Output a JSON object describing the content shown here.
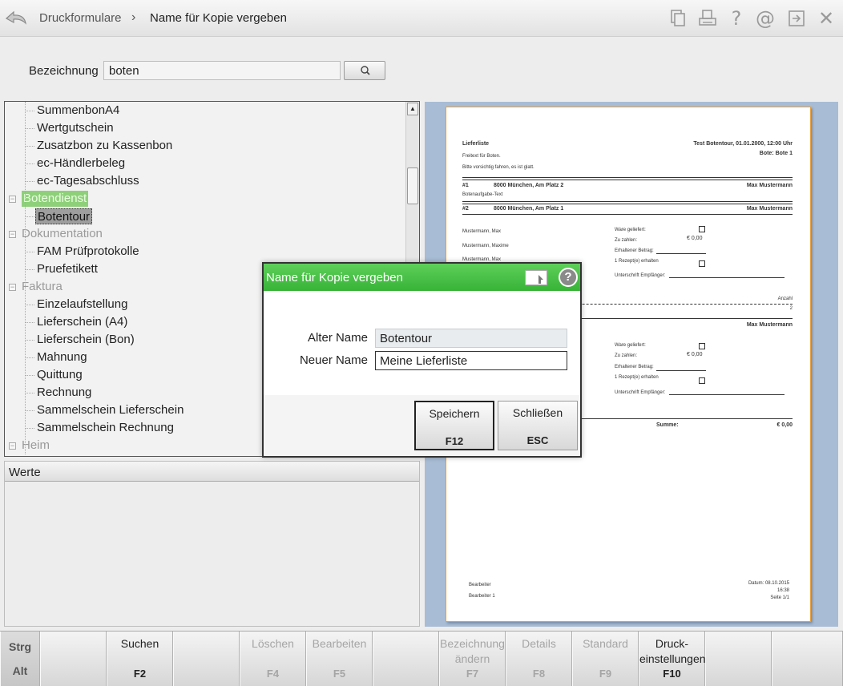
{
  "header": {
    "breadcrumb": [
      "Druckformulare",
      "Name für Kopie vergeben"
    ],
    "separator": "›",
    "icons": [
      "copy-document-icon",
      "print-icon",
      "help-icon",
      "email-at-icon",
      "window-switch-icon",
      "close-icon"
    ]
  },
  "search": {
    "label": "Bezeichnung",
    "value": "boten"
  },
  "tree": {
    "items": [
      {
        "type": "child",
        "label": "SummenbonA4"
      },
      {
        "type": "child",
        "label": "Wertgutschein"
      },
      {
        "type": "child",
        "label": "Zusatzbon zu Kassenbon"
      },
      {
        "type": "child",
        "label": "ec-Händlerbeleg"
      },
      {
        "type": "child",
        "label": "ec-Tagesabschluss"
      },
      {
        "type": "group",
        "label": "Botendienst"
      },
      {
        "type": "child",
        "label": "Botentour"
      },
      {
        "type": "group",
        "label": "Dokumentation"
      },
      {
        "type": "child",
        "label": "FAM Prüfprotokolle"
      },
      {
        "type": "child",
        "label": "Pruefetikett"
      },
      {
        "type": "group",
        "label": "Faktura"
      },
      {
        "type": "child",
        "label": "Einzelaufstellung"
      },
      {
        "type": "child",
        "label": "Lieferschein (A4)"
      },
      {
        "type": "child",
        "label": "Lieferschein (Bon)"
      },
      {
        "type": "child",
        "label": "Mahnung"
      },
      {
        "type": "child",
        "label": "Quittung"
      },
      {
        "type": "child",
        "label": "Rechnung"
      },
      {
        "type": "child",
        "label": "Sammelschein Lieferschein"
      },
      {
        "type": "child",
        "label": "Sammelschein Rechnung"
      },
      {
        "type": "group",
        "label": "Heim"
      }
    ]
  },
  "werte": {
    "title": "Werte"
  },
  "preview": {
    "title": "Lieferliste",
    "tour": "Test Botentour, 01.01.2000, 12:00 Uhr",
    "bote": "Bote: Bote 1",
    "freetext": "Freitext für Boten.",
    "note": "Bitte vorsichtig fahren, es ist glatt.",
    "stop1_no": "#1",
    "stop1_addr": "8000 München, Am Platz 2",
    "stop1_name": "Max Mustermann",
    "stop1_task": "Botenaufgabe-Text",
    "stop2_no": "#2",
    "stop2_addr": "8000 München, Am Platz 1",
    "stop2_name": "Max Mustermann",
    "person1": "Mustermann, Max",
    "person2": "Mustermann, Maxime",
    "person3": "Mustermann, Max",
    "ware": "Ware geliefert:",
    "zuzahlen": "Zu zahlen:",
    "betrag": "€ 0,00",
    "erhalten": "Erhaltener Betrag:",
    "rezept": "1 Rezept(e) erhalten",
    "unterschrift": "Unterschrift Empfänger:",
    "anzahl": "Anzahl",
    "anzahl_val": "2",
    "name3": "Max Mustermann",
    "summe": "Summe:",
    "summe_val": "€ 0,00",
    "bearbeiter": "Bearbeiter",
    "bearbeiter1": "Bearbeiter 1",
    "datum": "Datum: 08.10.2015",
    "uhrzeit": "16:38",
    "seite": "Seite 1/1"
  },
  "dialog": {
    "title": "Name für Kopie vergeben",
    "old_label": "Alter Name",
    "old_value": "Botentour",
    "new_label": "Neuer Name",
    "new_value": "Meine Lieferliste",
    "save_label": "Speichern",
    "save_key": "F12",
    "close_label": "Schließen",
    "close_key": "ESC"
  },
  "fkeys": {
    "strg": "Strg",
    "alt": "Alt",
    "keys": [
      {
        "label": "",
        "key": "",
        "enabled": false
      },
      {
        "label": "Suchen",
        "key": "F2",
        "enabled": true
      },
      {
        "label": "",
        "key": "",
        "enabled": false
      },
      {
        "label": "Löschen",
        "key": "F4",
        "enabled": false
      },
      {
        "label": "Bearbeiten",
        "key": "F5",
        "enabled": false
      },
      {
        "label": "",
        "key": "",
        "enabled": false
      },
      {
        "label": "Bezeichnung ändern",
        "key": "F7",
        "enabled": false
      },
      {
        "label": "Details",
        "key": "F8",
        "enabled": false
      },
      {
        "label": "Standard",
        "key": "F9",
        "enabled": false
      },
      {
        "label": "Druck-einstellungen",
        "key": "F10",
        "enabled": true
      },
      {
        "label": "",
        "key": "",
        "enabled": false
      },
      {
        "label": "",
        "key": "",
        "enabled": false
      }
    ]
  }
}
